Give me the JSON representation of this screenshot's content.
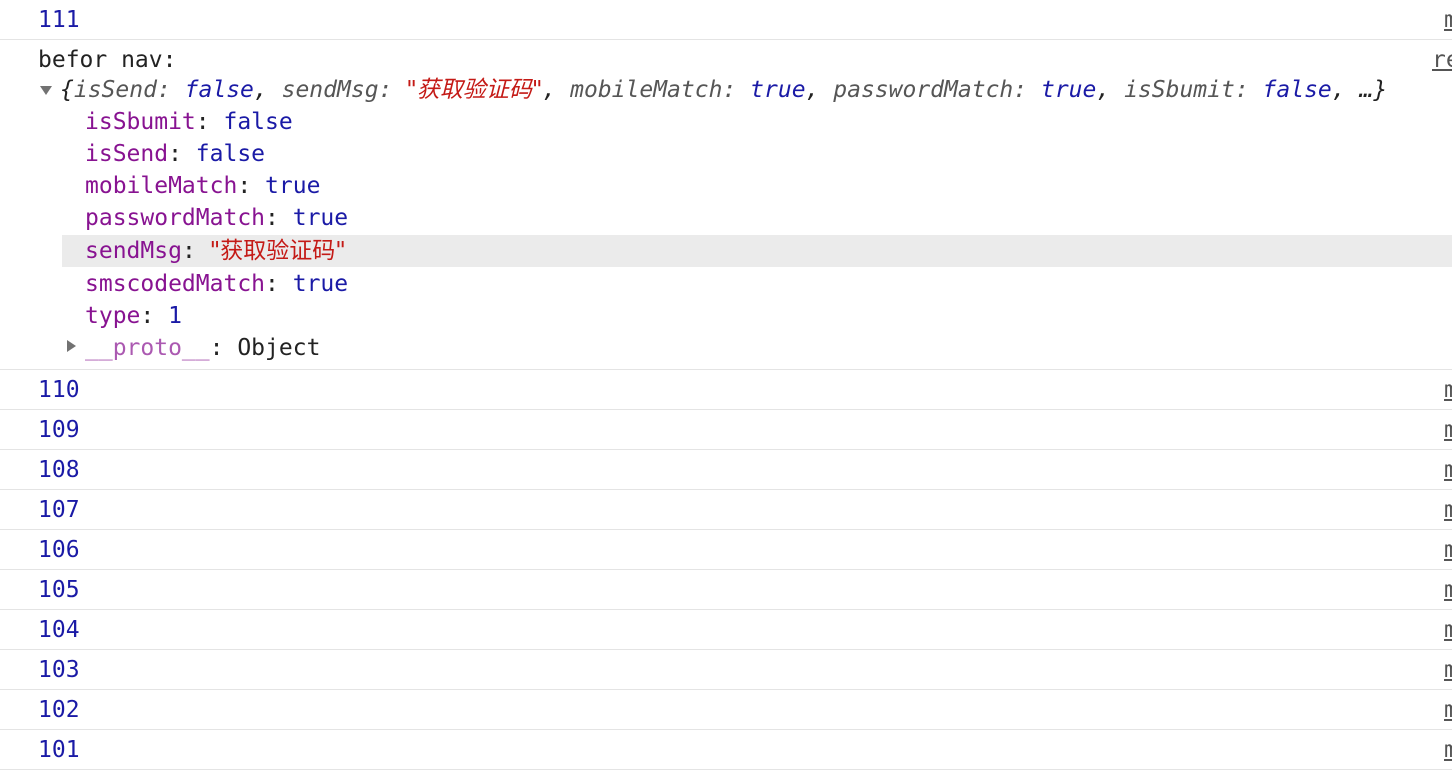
{
  "console": {
    "first_entry": {
      "value": "111",
      "source": "m"
    },
    "log_group": {
      "label": "befor nav:",
      "source": "re",
      "preview": {
        "open_brace": "{",
        "entries": [
          {
            "key": "isSend",
            "value": "false",
            "kind": "keyword"
          },
          {
            "key": "sendMsg",
            "value": "\"获取验证码\"",
            "kind": "string"
          },
          {
            "key": "mobileMatch",
            "value": "true",
            "kind": "keyword"
          },
          {
            "key": "passwordMatch",
            "value": "true",
            "kind": "keyword"
          },
          {
            "key": "isSbumit",
            "value": "false",
            "kind": "keyword"
          }
        ],
        "ellipsis": "…}"
      },
      "properties": [
        {
          "key": "isSbumit",
          "value": "false",
          "kind": "keyword"
        },
        {
          "key": "isSend",
          "value": "false",
          "kind": "keyword"
        },
        {
          "key": "mobileMatch",
          "value": "true",
          "kind": "keyword"
        },
        {
          "key": "passwordMatch",
          "value": "true",
          "kind": "keyword"
        },
        {
          "key": "sendMsg",
          "value": "\"获取验证码\"",
          "kind": "string",
          "highlighted": true
        },
        {
          "key": "smscodedMatch",
          "value": "true",
          "kind": "keyword"
        },
        {
          "key": "type",
          "value": "1",
          "kind": "number"
        }
      ],
      "proto": {
        "key": "__proto__",
        "value": "Object"
      }
    },
    "entries": [
      {
        "value": "110",
        "source": "m"
      },
      {
        "value": "109",
        "source": "m"
      },
      {
        "value": "108",
        "source": "m"
      },
      {
        "value": "107",
        "source": "m"
      },
      {
        "value": "106",
        "source": "m"
      },
      {
        "value": "105",
        "source": "m"
      },
      {
        "value": "104",
        "source": "m"
      },
      {
        "value": "103",
        "source": "m"
      },
      {
        "value": "102",
        "source": "m"
      },
      {
        "value": "101",
        "source": "m"
      }
    ]
  },
  "colors": {
    "key": "#881391",
    "keyword": "#1a1aa6",
    "string": "#c41a16",
    "divider": "#e4e4e4",
    "hover": "#ebebeb"
  },
  "icons": {
    "expanded": "triangle-down-icon",
    "collapsed": "triangle-right-icon"
  }
}
